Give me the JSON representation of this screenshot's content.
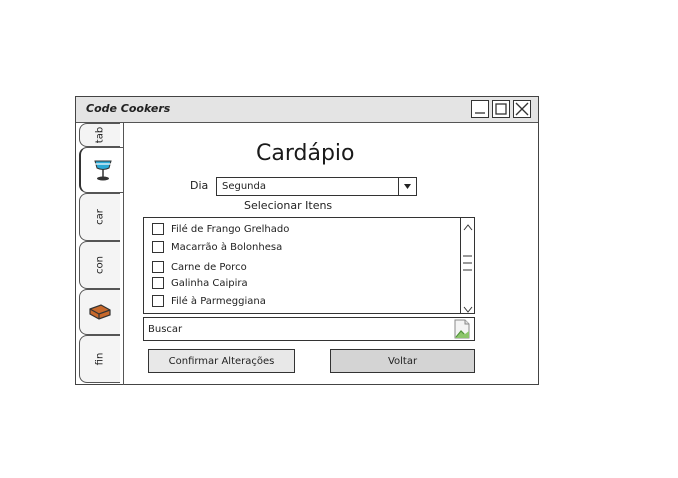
{
  "window": {
    "title": "Code Cookers"
  },
  "tabs": [
    {
      "label": "tab",
      "type": "text"
    },
    {
      "label": "",
      "type": "icon",
      "icon": "drink-icon"
    },
    {
      "label": "car",
      "type": "text"
    },
    {
      "label": "con",
      "type": "text"
    },
    {
      "label": "",
      "type": "icon",
      "icon": "brick-icon"
    },
    {
      "label": "fin",
      "type": "text"
    }
  ],
  "main": {
    "title": "Cardápio",
    "day_label": "Dia",
    "day_value": "Segunda",
    "select_items_label": "Selecionar Itens",
    "items": [
      {
        "label": "Filé de Frango Grelhado",
        "checked": false
      },
      {
        "label": "Macarrão à Bolonhesa",
        "checked": false
      },
      {
        "label": "Carne de Porco",
        "checked": false
      },
      {
        "label": "Galinha Caipira",
        "checked": false
      },
      {
        "label": "Filé à Parmeggiana",
        "checked": false
      }
    ],
    "search_placeholder": "Buscar",
    "confirm_label": "Confirmar Alterações",
    "back_label": "Voltar"
  },
  "colors": {
    "titlebar": "#e4e4e4",
    "drink_icon": "#2aa9d6",
    "brick_icon": "#c8692c"
  }
}
